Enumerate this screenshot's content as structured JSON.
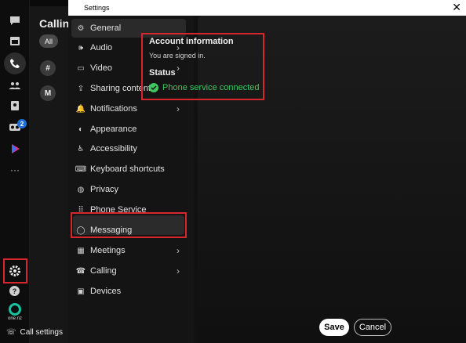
{
  "window": {
    "title": "Settings",
    "close_glyph": "✕"
  },
  "rail": {
    "items": [
      "chat-icon",
      "calendar-icon",
      "phone-icon",
      "contacts-icon",
      "directory-icon",
      "voicemail-icon",
      "vidcast-icon",
      "more-icon"
    ],
    "voicemail_badge": "2",
    "help_label": "?",
    "brand_label": "one.nz"
  },
  "calling": {
    "title": "Calling",
    "filter_all": "All",
    "dialpad_label": "#",
    "avatar_initial": "M",
    "call_settings": "Call settings"
  },
  "nav": {
    "items": [
      {
        "label": "General",
        "icon": "gear-icon"
      },
      {
        "label": "Audio",
        "icon": "speaker-icon",
        "chevron": true
      },
      {
        "label": "Video",
        "icon": "video-icon",
        "chevron": true
      },
      {
        "label": "Sharing content",
        "icon": "share-icon"
      },
      {
        "label": "Notifications",
        "icon": "bell-icon",
        "chevron": true
      },
      {
        "label": "Appearance",
        "icon": "appearance-icon"
      },
      {
        "label": "Accessibility",
        "icon": "accessibility-icon"
      },
      {
        "label": "Keyboard shortcuts",
        "icon": "keyboard-icon"
      },
      {
        "label": "Privacy",
        "icon": "privacy-icon"
      },
      {
        "label": "Phone Service",
        "icon": "dialpad-icon"
      },
      {
        "label": "Messaging",
        "icon": "message-icon"
      },
      {
        "label": "Meetings",
        "icon": "calendar-icon",
        "chevron": true
      },
      {
        "label": "Calling",
        "icon": "handset-icon",
        "chevron": true
      },
      {
        "label": "Devices",
        "icon": "devices-icon"
      }
    ],
    "chevron": "›"
  },
  "content": {
    "account_title": "Account information",
    "account_status": "You are signed in.",
    "status_title": "Status",
    "status_text": "Phone service connected",
    "status_color": "#3ec85f"
  },
  "footer": {
    "save": "Save",
    "cancel": "Cancel"
  },
  "accent_highlight": "#d7262e"
}
